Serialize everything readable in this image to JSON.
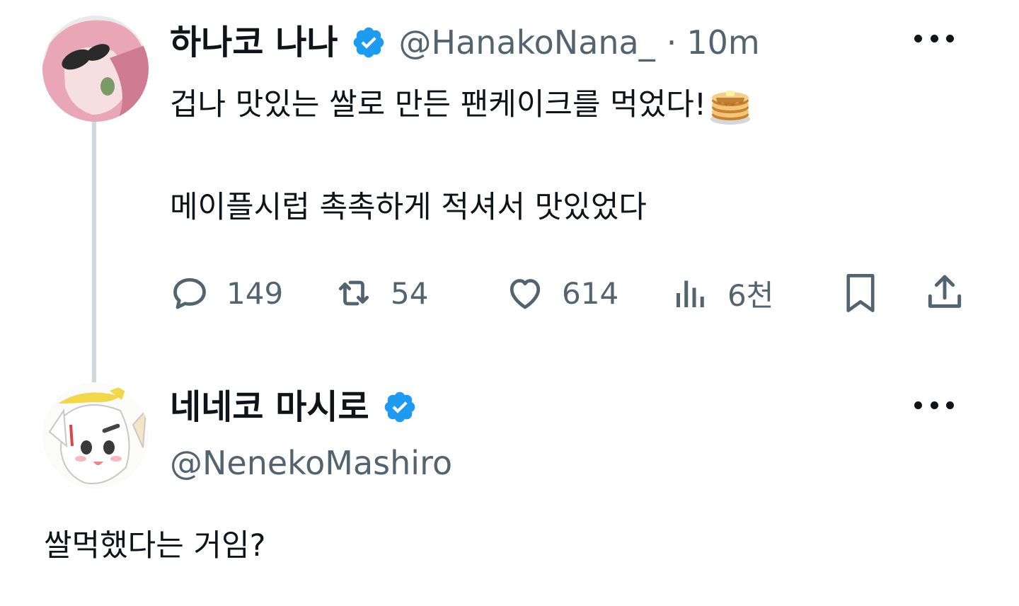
{
  "tweet": {
    "author_name": "하나코 나나",
    "handle": "@HanakoNana_",
    "separator": "·",
    "time": "10m",
    "line1": "겁나 맛있는 쌀로 만든 팬케이크를 먹었다!",
    "emoji": "pancakes-emoji",
    "line2": "메이플시럽 촉촉하게 적셔서 맛있었다",
    "actions": {
      "reply_count": "149",
      "retweet_count": "54",
      "like_count": "614",
      "views_count": "6천"
    }
  },
  "reply": {
    "author_name": "네네코 마시로",
    "handle": "@NenekoMashiro",
    "text": "쌀먹했다는 거임?"
  },
  "colors": {
    "verified": "#1d9bf0",
    "muted": "#536471",
    "thread_line": "#cfd9de",
    "text": "#0f1419"
  },
  "icons": [
    "verified-badge-icon",
    "more-icon",
    "reply-icon",
    "retweet-icon",
    "like-icon",
    "views-icon",
    "bookmark-icon",
    "share-icon"
  ]
}
